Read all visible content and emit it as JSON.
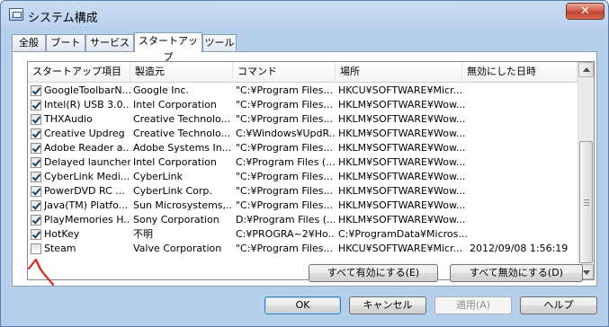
{
  "window": {
    "title": "システム構成",
    "close_glyph": "✕"
  },
  "tabs": [
    {
      "label": "全般"
    },
    {
      "label": "ブート"
    },
    {
      "label": "サービス"
    },
    {
      "label": "スタートアップ"
    },
    {
      "label": "ツール"
    }
  ],
  "list": {
    "columns": [
      "スタートアップ項目",
      "製造元",
      "コマンド",
      "場所",
      "無効にした日時"
    ],
    "rows": [
      {
        "checked": true,
        "cells": [
          "GoogleToolbarN...",
          "Google Inc.",
          "\"C:¥Program Files...",
          "HKCU¥SOFTWARE¥Micr...",
          ""
        ]
      },
      {
        "checked": true,
        "cells": [
          "Intel(R) USB 3.0...",
          "Intel Corporation",
          "\"C:¥Program Files...",
          "HKLM¥SOFTWARE¥Wow...",
          ""
        ]
      },
      {
        "checked": true,
        "cells": [
          "THXAudio",
          "Creative Technolo...",
          "\"C:¥Program Files...",
          "HKLM¥SOFTWARE¥Wow...",
          ""
        ]
      },
      {
        "checked": true,
        "cells": [
          "Creative Updreg",
          "Creative Technolo...",
          "C:¥Windows¥UpdR...",
          "HKLM¥SOFTWARE¥Wow...",
          ""
        ]
      },
      {
        "checked": true,
        "cells": [
          "Adobe Reader a...",
          "Adobe Systems In...",
          "\"C:¥Program Files...",
          "HKLM¥SOFTWARE¥Wow...",
          ""
        ]
      },
      {
        "checked": true,
        "cells": [
          "Delayed launcher",
          "Intel Corporation",
          "C:¥Program Files (...",
          "HKLM¥SOFTWARE¥Wow...",
          ""
        ]
      },
      {
        "checked": true,
        "cells": [
          "CyberLink Medi...",
          "CyberLink",
          "\"C:¥Program Files...",
          "HKLM¥SOFTWARE¥Wow...",
          ""
        ]
      },
      {
        "checked": true,
        "cells": [
          "PowerDVD RC ...",
          "CyberLink Corp.",
          "\"C:¥Program Files...",
          "HKLM¥SOFTWARE¥Wow...",
          ""
        ]
      },
      {
        "checked": true,
        "cells": [
          "Java(TM) Platfo...",
          "Sun Microsystems,...",
          "\"C:¥Program Files...",
          "HKLM¥SOFTWARE¥Wow...",
          ""
        ]
      },
      {
        "checked": true,
        "cells": [
          "PlayMemories H...",
          "Sony Corporation",
          "D:¥Program Files (...",
          "HKLM¥SOFTWARE¥Wow...",
          ""
        ]
      },
      {
        "checked": true,
        "cells": [
          "HotKey",
          "不明",
          "C:¥PROGRA~2¥Ho...",
          "C:¥ProgramData¥Micros...",
          ""
        ]
      },
      {
        "checked": false,
        "cells": [
          "Steam",
          "Valve Corporation",
          "\"C:¥Program Files...",
          "HKCU¥SOFTWARE¥Micr...",
          "2012/09/08 1:56:19"
        ]
      }
    ]
  },
  "actions": {
    "enable_all": "すべて有効にする(E)",
    "disable_all": "すべて無効にする(D)"
  },
  "footer": {
    "ok": "OK",
    "cancel": "キャンセル",
    "apply": "適用(A)",
    "help": "ヘルプ"
  },
  "colors": {
    "annotation_arrow": "#e0281e"
  }
}
